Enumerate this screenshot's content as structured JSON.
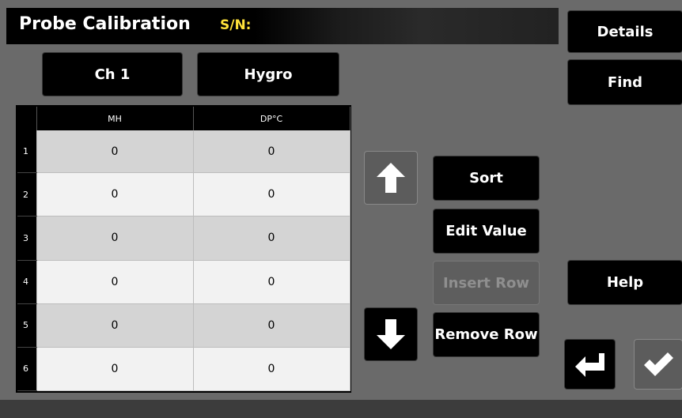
{
  "header": {
    "title": "Probe Calibration",
    "serial_label": "S/N:"
  },
  "selectors": {
    "channel": "Ch 1",
    "probe_type": "Hygro"
  },
  "table": {
    "columns": [
      "MH",
      "DP°C"
    ],
    "rows": [
      {
        "index": "1",
        "mh": "0",
        "dp": "0"
      },
      {
        "index": "2",
        "mh": "0",
        "dp": "0"
      },
      {
        "index": "3",
        "mh": "0",
        "dp": "0"
      },
      {
        "index": "4",
        "mh": "0",
        "dp": "0"
      },
      {
        "index": "5",
        "mh": "0",
        "dp": "0"
      },
      {
        "index": "6",
        "mh": "0",
        "dp": "0"
      }
    ]
  },
  "actions": {
    "sort": "Sort",
    "edit_value": "Edit Value",
    "insert_row": "Insert Row",
    "remove_row": "Remove Row"
  },
  "side": {
    "details": "Details",
    "find": "Find",
    "help": "Help"
  },
  "icons": {
    "up": "arrow-up-icon",
    "down": "arrow-down-icon",
    "back": "return-arrow-icon",
    "ok": "checkmark-icon"
  },
  "colors": {
    "serial_label": "#ffe23a",
    "button": "#000000",
    "disabled_button": "#5e5e5e",
    "row_odd": "#d4d4d4",
    "row_even": "#f2f2f2"
  }
}
